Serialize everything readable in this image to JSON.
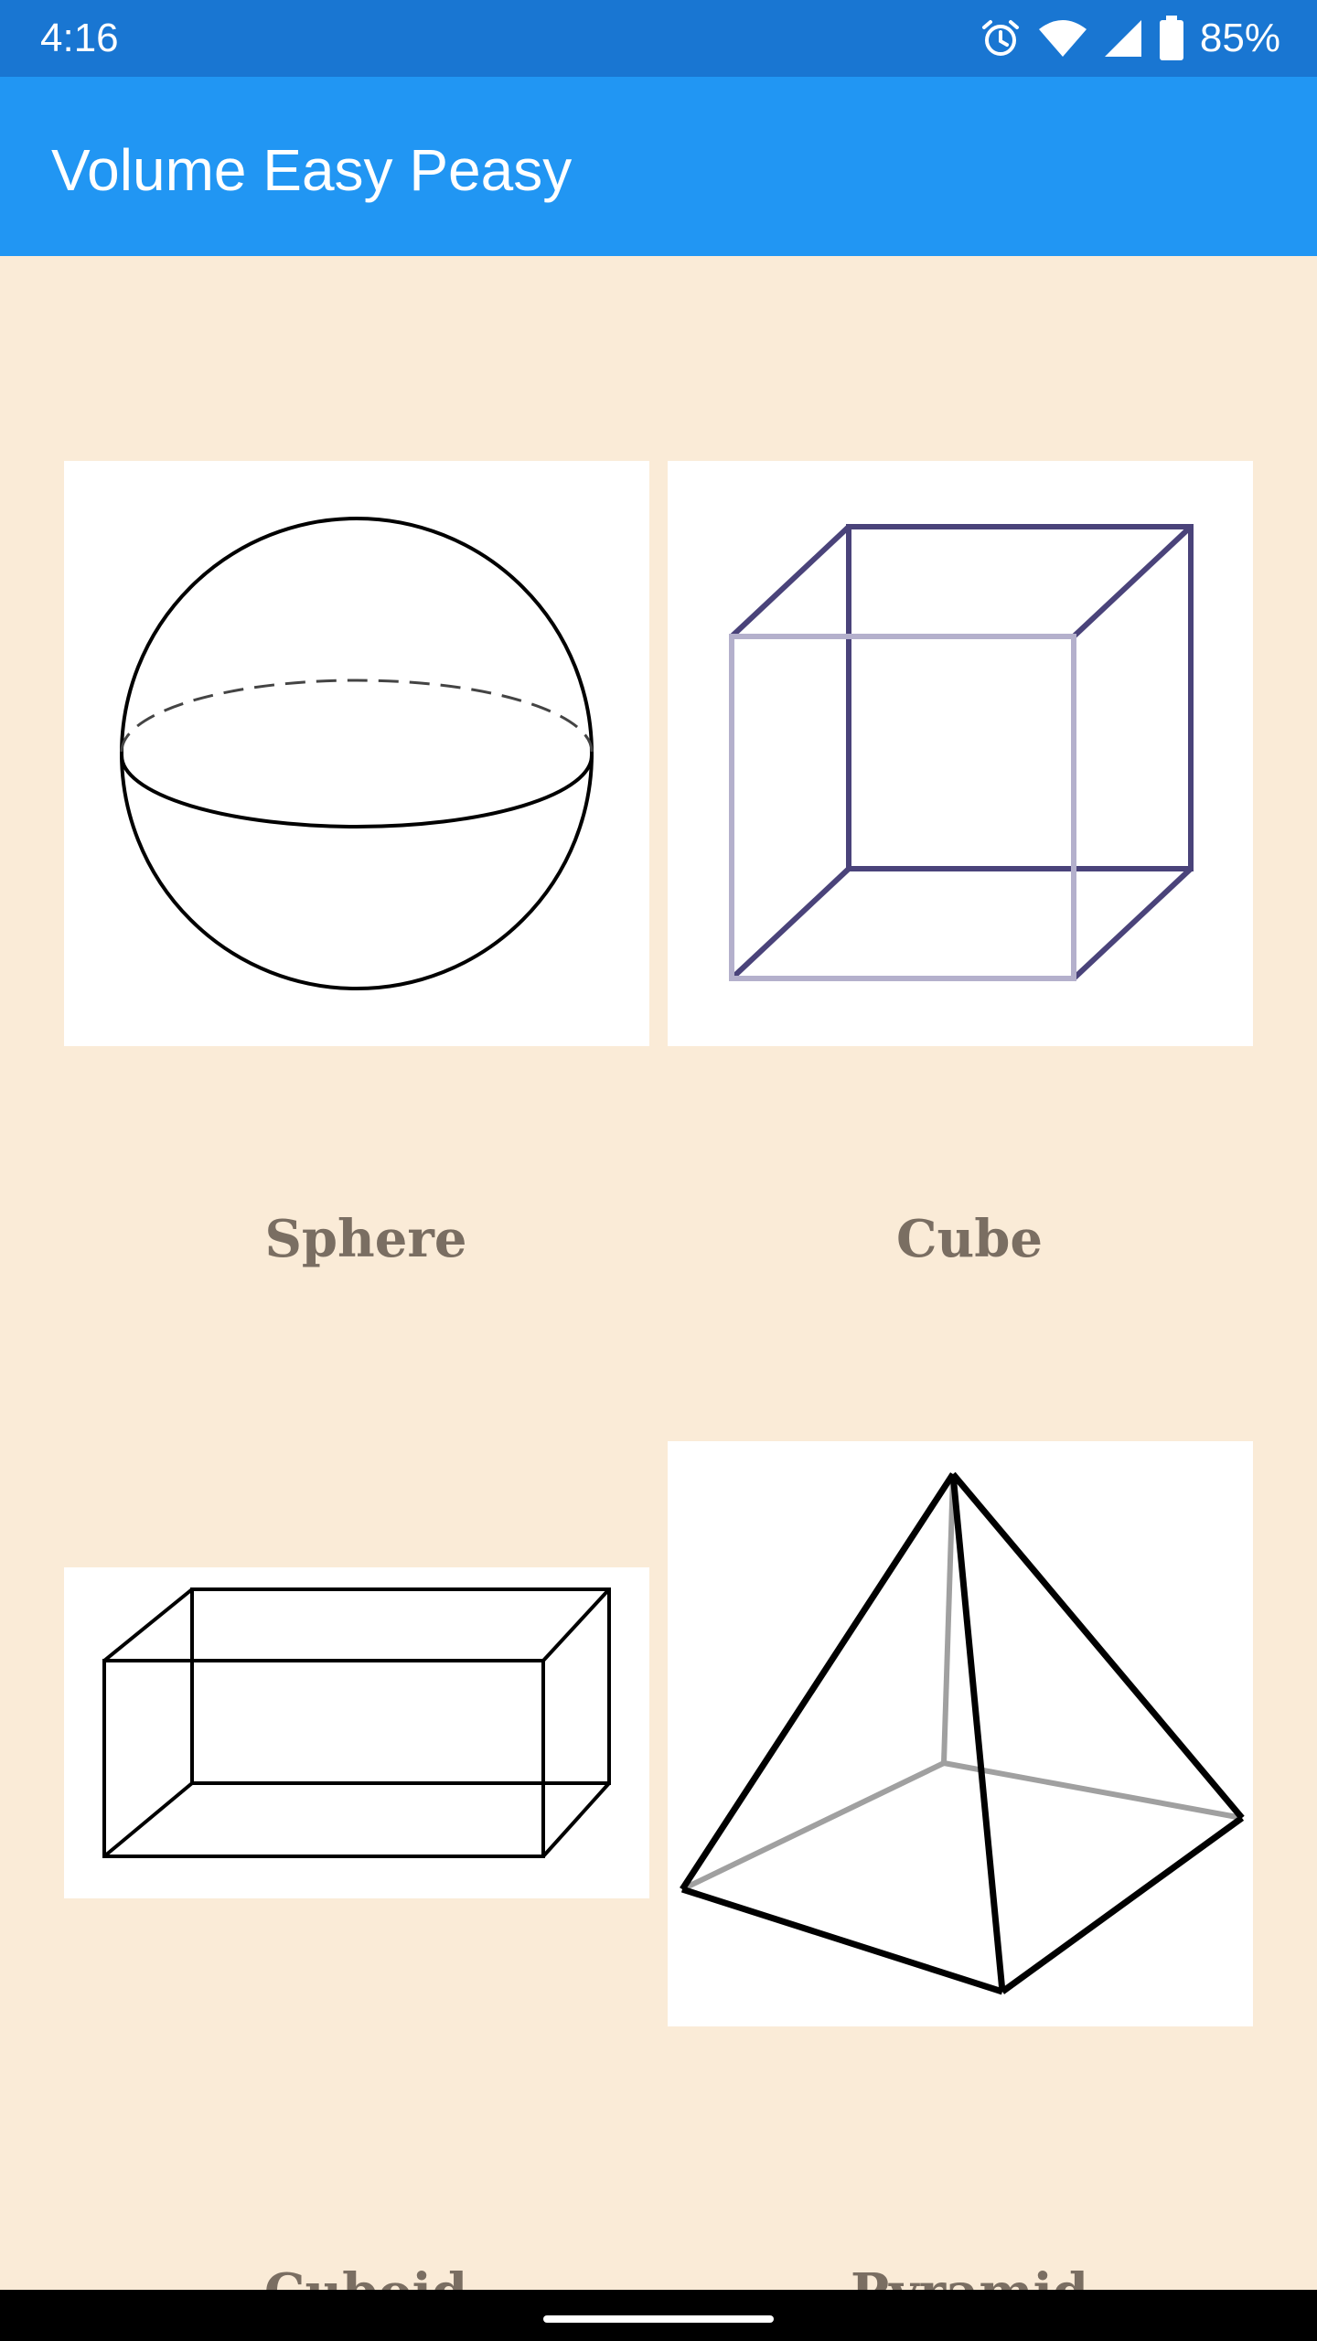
{
  "status_bar": {
    "time": "4:16",
    "battery_percent": "85%",
    "icons": [
      "alarm-icon",
      "wifi-icon",
      "signal-icon",
      "battery-icon"
    ]
  },
  "app_bar": {
    "title": "Volume Easy Peasy",
    "color": "#2196F3"
  },
  "shapes": [
    {
      "label": "Sphere",
      "icon": "sphere-icon"
    },
    {
      "label": "Cube",
      "icon": "cube-icon"
    },
    {
      "label": "Cuboid",
      "icon": "cuboid-icon"
    },
    {
      "label": "Pyramid",
      "icon": "pyramid-icon"
    }
  ],
  "colors": {
    "background": "#FAEBD7",
    "status_bar": "#1976D2",
    "label_text": "#7a6e62"
  }
}
